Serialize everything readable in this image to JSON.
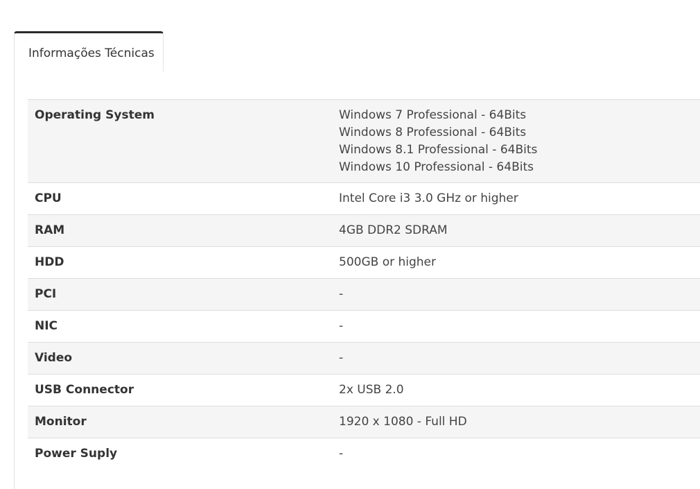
{
  "tabs": [
    {
      "label": "Informações Técnicas",
      "active": true
    }
  ],
  "specs": [
    {
      "key": "Operating System",
      "values": [
        "Windows 7 Professional - 64Bits",
        "Windows 8 Professional - 64Bits",
        "Windows 8.1 Professional - 64Bits",
        "Windows 10 Professional - 64Bits"
      ]
    },
    {
      "key": "CPU",
      "values": [
        "Intel Core i3 3.0 GHz or higher"
      ]
    },
    {
      "key": "RAM",
      "values": [
        "4GB DDR2 SDRAM"
      ]
    },
    {
      "key": "HDD",
      "values": [
        "500GB or higher"
      ]
    },
    {
      "key": "PCI",
      "values": [
        "-"
      ]
    },
    {
      "key": "NIC",
      "values": [
        "-"
      ]
    },
    {
      "key": "Video",
      "values": [
        "-"
      ]
    },
    {
      "key": "USB Connector",
      "values": [
        "2x USB 2.0"
      ]
    },
    {
      "key": "Monitor",
      "values": [
        "1920 x 1080 - Full HD"
      ]
    },
    {
      "key": "Power Suply",
      "values": [
        "-"
      ]
    }
  ],
  "colors": {
    "tab_top_border": "#2b2b2b",
    "row_stripe": "#f5f5f5",
    "row_border": "#dddddd",
    "text": "#333333"
  }
}
